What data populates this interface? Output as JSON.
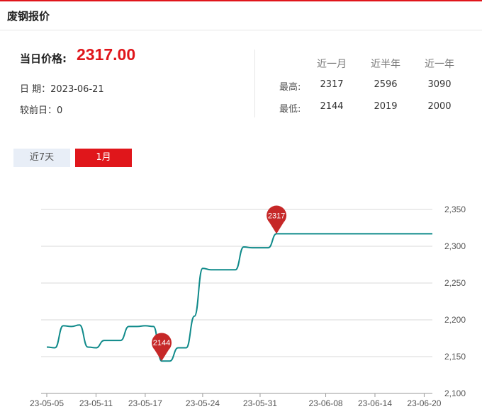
{
  "header": {
    "title": "废钢报价"
  },
  "summary": {
    "price_label": "当日价格:",
    "price_value": "2317.00",
    "date_text": "日  期：2023-06-21",
    "change_text": "较前日：0"
  },
  "stats": {
    "columns": [
      "近一月",
      "近半年",
      "近一年"
    ],
    "rows": [
      {
        "label": "最高:",
        "values": [
          "2317",
          "2596",
          "3090"
        ]
      },
      {
        "label": "最低:",
        "values": [
          "2144",
          "2019",
          "2000"
        ]
      }
    ]
  },
  "tabs": [
    {
      "label": "近7天",
      "active": false
    },
    {
      "label": "1月",
      "active": true
    }
  ],
  "colors": {
    "accent": "#e0161b",
    "line": "#0f8a8a",
    "marker": "#c62828"
  },
  "chart_data": {
    "type": "line",
    "ylim": [
      2100,
      2350
    ],
    "yticks": [
      2100,
      2150,
      2200,
      2250,
      2300,
      2350
    ],
    "ytick_labels": [
      "2,100",
      "2,150",
      "2,200",
      "2,250",
      "2,300",
      "2,350"
    ],
    "xtick_labels": [
      "23-05-05",
      "23-05-11",
      "23-05-17",
      "23-05-24",
      "23-05-31",
      "23-06-08",
      "23-06-14",
      "23-06-20"
    ],
    "grid": true,
    "series": [
      {
        "x": [
          "23-05-05",
          "23-05-06",
          "23-05-07",
          "23-05-08",
          "23-05-09",
          "23-05-10",
          "23-05-11",
          "23-05-12",
          "23-05-13",
          "23-05-14",
          "23-05-15",
          "23-05-16",
          "23-05-17",
          "23-05-18",
          "23-05-19",
          "23-05-20",
          "23-05-21",
          "23-05-22",
          "23-05-23",
          "23-05-24",
          "23-05-25",
          "23-05-26",
          "23-05-27",
          "23-05-28",
          "23-05-29",
          "23-05-30",
          "23-05-31",
          "23-06-01",
          "23-06-02",
          "23-06-03",
          "23-06-04",
          "23-06-05",
          "23-06-06",
          "23-06-07",
          "23-06-08",
          "23-06-09",
          "23-06-10",
          "23-06-11",
          "23-06-12",
          "23-06-13",
          "23-06-14",
          "23-06-15",
          "23-06-16",
          "23-06-17",
          "23-06-18",
          "23-06-19",
          "23-06-20",
          "23-06-21"
        ],
        "values": [
          2163,
          2162,
          2192,
          2191,
          2193,
          2163,
          2162,
          2172,
          2172,
          2172,
          2191,
          2191,
          2192,
          2191,
          2144,
          2144,
          2162,
          2162,
          2205,
          2270,
          2268,
          2268,
          2268,
          2268,
          2299,
          2298,
          2298,
          2298,
          2317,
          2317,
          2317,
          2317,
          2317,
          2317,
          2317,
          2317,
          2317,
          2317,
          2317,
          2317,
          2317,
          2317,
          2317,
          2317,
          2317,
          2317,
          2317,
          2317
        ]
      }
    ],
    "annotations": [
      {
        "label": "2144",
        "value": 2144
      },
      {
        "label": "2317",
        "value": 2317
      }
    ]
  }
}
